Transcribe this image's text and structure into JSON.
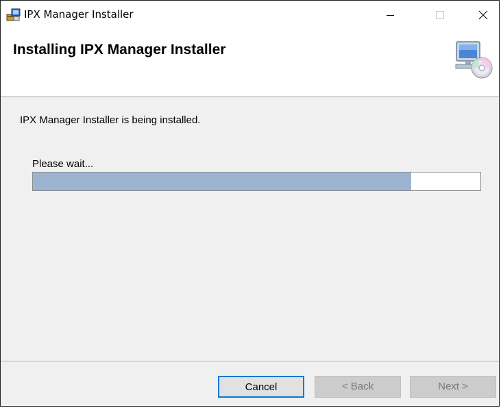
{
  "window": {
    "title": "IPX Manager Installer"
  },
  "banner": {
    "title": "Installing IPX Manager Installer"
  },
  "main": {
    "status_text": "IPX Manager Installer is being installed.",
    "wait_label": "Please wait...",
    "progress_percent": 84.5
  },
  "buttons": {
    "cancel": "Cancel",
    "back": "< Back",
    "next": "Next >"
  },
  "colors": {
    "progress_fill": "#9bb5d1",
    "focus_border": "#0078d7"
  }
}
